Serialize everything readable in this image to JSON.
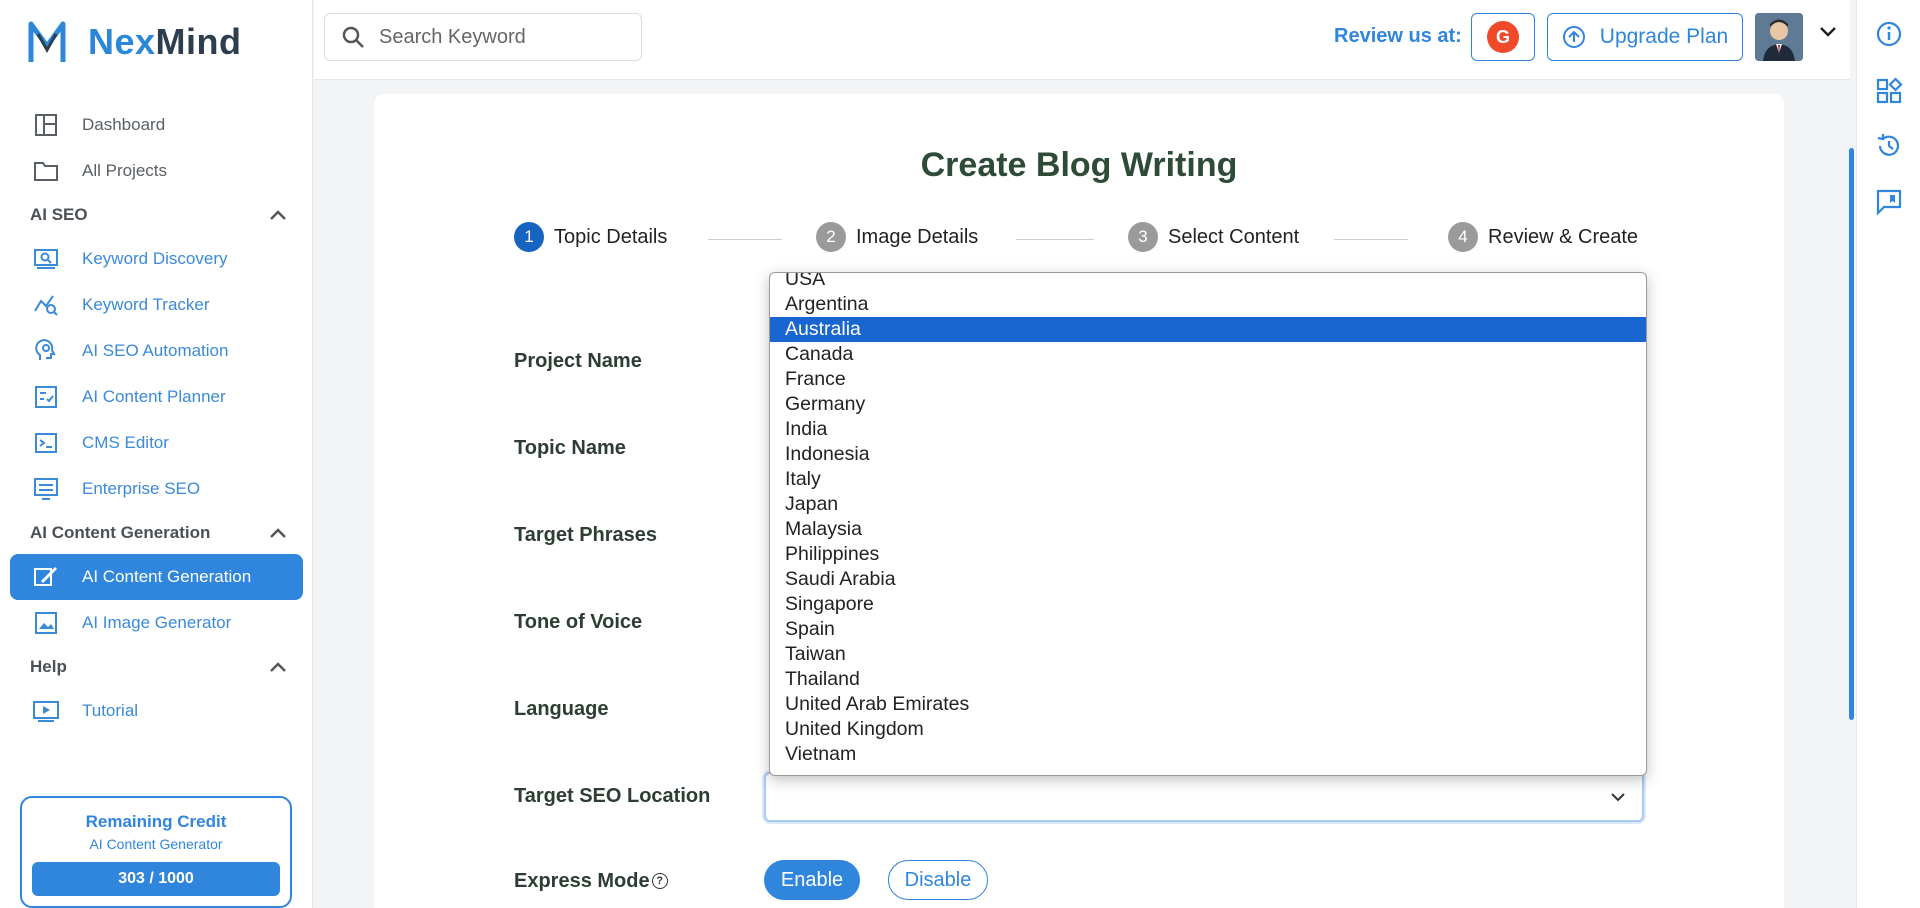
{
  "brand": {
    "prefix": "Nex",
    "suffix": "Mind"
  },
  "sidebar": {
    "top_items": [
      {
        "label": "Dashboard",
        "icon": "dashboard-icon"
      },
      {
        "label": "All Projects",
        "icon": "folder-icon"
      }
    ],
    "sections": [
      {
        "title": "AI SEO",
        "items": [
          {
            "label": "Keyword Discovery",
            "icon": "keyword-discovery-icon"
          },
          {
            "label": "Keyword Tracker",
            "icon": "tracker-icon"
          },
          {
            "label": "AI SEO Automation",
            "icon": "automation-icon"
          },
          {
            "label": "AI Content Planner",
            "icon": "planner-icon"
          },
          {
            "label": "CMS Editor",
            "icon": "cms-icon"
          },
          {
            "label": "Enterprise SEO",
            "icon": "enterprise-icon"
          }
        ]
      },
      {
        "title": "AI Content Generation",
        "items": [
          {
            "label": "AI Content Generation",
            "icon": "content-generation-icon",
            "active": true
          },
          {
            "label": "AI Image Generator",
            "icon": "image-icon"
          }
        ]
      },
      {
        "title": "Help",
        "items": [
          {
            "label": "Tutorial",
            "icon": "play-icon"
          }
        ]
      }
    ],
    "credit": {
      "title": "Remaining Credit",
      "subtitle": "AI Content Generator",
      "value": "303 / 1000"
    }
  },
  "topbar": {
    "search_placeholder": "Search Keyword",
    "review_label": "Review us at:",
    "g2_label": "G",
    "upgrade_label": "Upgrade Plan"
  },
  "page": {
    "title": "Create Blog Writing",
    "steps": [
      {
        "num": "1",
        "label": "Topic Details",
        "active": true
      },
      {
        "num": "2",
        "label": "Image Details"
      },
      {
        "num": "3",
        "label": "Select Content"
      },
      {
        "num": "4",
        "label": "Review & Create"
      }
    ],
    "fields": {
      "project_name": "Project Name",
      "topic_name": "Topic Name",
      "target_phrases": "Target Phrases",
      "tone_of_voice": "Tone of Voice",
      "language": "Language",
      "target_seo_location": "Target SEO Location",
      "express_mode": "Express Mode"
    },
    "express": {
      "enable": "Enable",
      "disable": "Disable",
      "help": "?"
    },
    "location_options": [
      "USA",
      "Argentina",
      "Australia",
      "Canada",
      "France",
      "Germany",
      "India",
      "Indonesia",
      "Italy",
      "Japan",
      "Malaysia",
      "Philippines",
      "Saudi Arabia",
      "Singapore",
      "Spain",
      "Taiwan",
      "Thailand",
      "United Arab Emirates",
      "United Kingdom",
      "Vietnam"
    ],
    "highlighted_option": "Australia"
  },
  "colors": {
    "accent": "#2f86dc",
    "title": "#2e4b37",
    "selected": "#1a66d1",
    "g2": "#ef4a2a"
  }
}
